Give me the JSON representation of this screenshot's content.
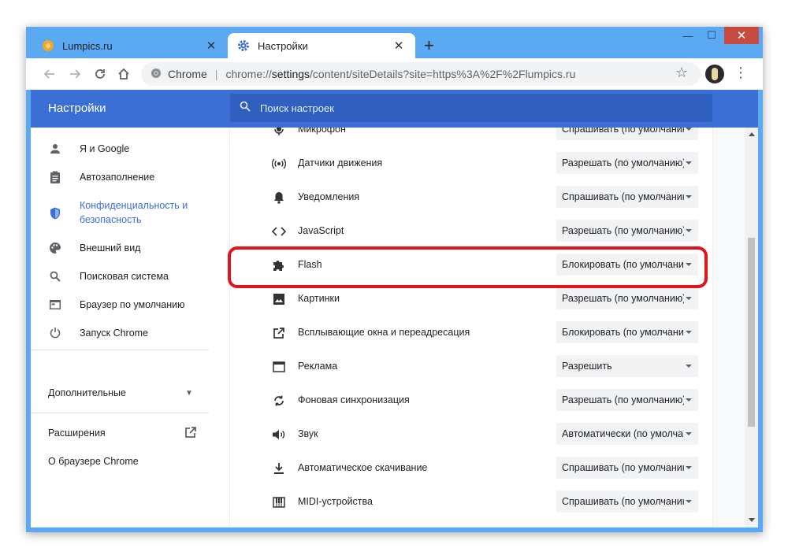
{
  "browser": {
    "tabs": [
      {
        "title": "Lumpics.ru",
        "active": false,
        "favicon": "orange-circle-icon"
      },
      {
        "title": "Настройки",
        "active": true,
        "favicon": "gear-icon"
      }
    ],
    "new_tab": "+",
    "window_controls": {
      "minimize": "—",
      "maximize": "☐",
      "close": "✕"
    },
    "omnibox": {
      "security_label": "Chrome",
      "separator": "|",
      "url_prefix": "chrome://",
      "url_host": "settings",
      "url_rest": "/content/siteDetails?site=https%3A%2F%2Flumpics.ru"
    }
  },
  "settings": {
    "title": "Настройки",
    "search": {
      "placeholder": "Поиск настроек"
    },
    "sidebar": {
      "items": [
        {
          "label": "Я и Google",
          "icon": "person-icon"
        },
        {
          "label": "Автозаполнение",
          "icon": "clipboard-icon"
        },
        {
          "label": "Конфиденциальность и безопасность",
          "label_line1": "Конфиденциальность и",
          "label_line2": "безопасность",
          "icon": "shield-icon",
          "active": true
        },
        {
          "label": "Внешний вид",
          "icon": "palette-icon"
        },
        {
          "label": "Поисковая система",
          "icon": "search-icon"
        },
        {
          "label": "Браузер по умолчанию",
          "icon": "browser-icon"
        },
        {
          "label": "Запуск Chrome",
          "icon": "power-icon"
        }
      ],
      "advanced": "Дополнительные",
      "extensions": "Расширения",
      "about": "О браузере Chrome"
    },
    "permissions": [
      {
        "label": "Микрофон",
        "value": "Спрашивать (по умолчанию)",
        "icon": "microphone-icon"
      },
      {
        "label": "Датчики движения",
        "value": "Разрешать (по умолчанию)",
        "icon": "motion-sensor-icon"
      },
      {
        "label": "Уведомления",
        "value": "Спрашивать (по умолчанию)",
        "icon": "bell-icon"
      },
      {
        "label": "JavaScript",
        "value": "Разрешать (по умолчанию)",
        "icon": "code-icon"
      },
      {
        "label": "Flash",
        "value": "Блокировать (по умолчанию)",
        "icon": "puzzle-icon"
      },
      {
        "label": "Картинки",
        "value": "Разрешать (по умолчанию)",
        "icon": "image-icon"
      },
      {
        "label": "Всплывающие окна и переадресация",
        "value": "Блокировать (по умолчанию)",
        "icon": "open-in-new-icon"
      },
      {
        "label": "Реклама",
        "value": "Разрешить",
        "icon": "ads-window-icon"
      },
      {
        "label": "Фоновая синхронизация",
        "value": "Разрешать (по умолчанию)",
        "icon": "sync-icon"
      },
      {
        "label": "Звук",
        "value": "Автоматически (по умолчанию)",
        "icon": "speaker-icon"
      },
      {
        "label": "Автоматическое скачивание",
        "value": "Спрашивать (по умолчанию)",
        "icon": "download-icon"
      },
      {
        "label": "MIDI-устройства",
        "value": "Спрашивать (по умолчанию)",
        "icon": "piano-icon"
      }
    ]
  },
  "colors": {
    "header_blue": "#3b6fd6",
    "window_frame": "#5aa9f2",
    "highlight_red": "#e0141b",
    "active_link": "#3b6fd6"
  }
}
